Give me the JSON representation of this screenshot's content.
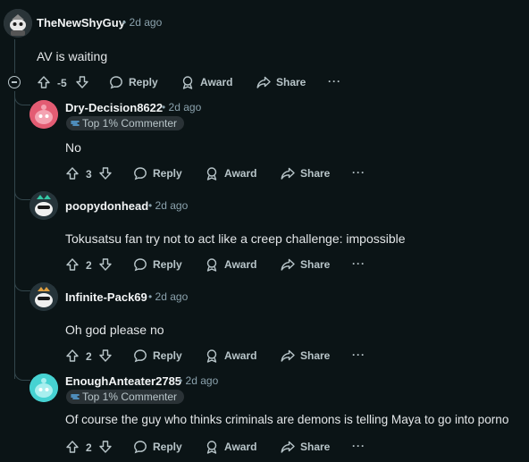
{
  "parent": {
    "username": "TheNewShyGuy",
    "timestamp": "2d ago",
    "body": "AV is waiting",
    "votes": "-5",
    "reply_label": "Reply",
    "award_label": "Award",
    "share_label": "Share",
    "more_label": "···"
  },
  "replies": [
    {
      "username": "Dry-Decision8622",
      "timestamp": "2d ago",
      "flair": "Top 1% Commenter",
      "body": "No",
      "votes": "3",
      "reply_label": "Reply",
      "award_label": "Award",
      "share_label": "Share",
      "more_label": "···",
      "avatar_color": "#e35c73"
    },
    {
      "username": "poopydonhead",
      "timestamp": "2d ago",
      "body": "Tokusatsu fan try not to act like a creep challenge: impossible",
      "votes": "2",
      "reply_label": "Reply",
      "award_label": "Award",
      "share_label": "Share",
      "more_label": "···",
      "avatar_color": "#2c3a3f"
    },
    {
      "username": "Infinite-Pack69",
      "timestamp": "2d ago",
      "body": "Oh god please no",
      "votes": "2",
      "reply_label": "Reply",
      "award_label": "Award",
      "share_label": "Share",
      "more_label": "···",
      "avatar_color": "#2c3a3f"
    },
    {
      "username": "EnoughAnteater2785",
      "timestamp": "2d ago",
      "flair": "Top 1% Commenter",
      "body": "Of course the guy who thinks criminals are demons is telling Maya to go into porno",
      "votes": "2",
      "reply_label": "Reply",
      "award_label": "Award",
      "share_label": "Share",
      "more_label": "···",
      "avatar_color": "#46d2d2"
    }
  ],
  "colors": {
    "background": "#0b1416",
    "thread_line": "#33464c",
    "muted_text": "#8ba2ad",
    "flair_icon": "#5aa9e6"
  },
  "icons": {
    "upvote": "arrow-up-icon",
    "downvote": "arrow-down-icon",
    "reply": "speech-bubble-icon",
    "award": "award-ribbon-icon",
    "share": "share-arrow-icon",
    "collapse": "collapse-minus-icon"
  }
}
